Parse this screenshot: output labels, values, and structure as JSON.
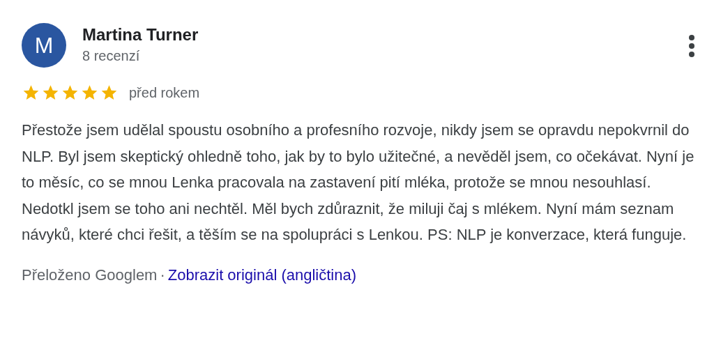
{
  "review": {
    "avatar_letter": "M",
    "author": "Martina Turner",
    "review_count": "8 recenzí",
    "stars": 5,
    "time": "před rokem",
    "text": "Přestože jsem udělal spoustu osobního a profesního rozvoje, nikdy jsem se opravdu nepokvrnil do NLP. Byl jsem skeptický ohledně toho, jak by to bylo užitečné, a nevěděl jsem, co očekávat. Nyní je to měsíc, co se mnou Lenka pracovala na zastavení pití mléka, protože se mnou nesouhlasí. Nedotkl jsem se toho ani nechtěl. Měl bych zdůraznit, že miluji čaj s mlékem. Nyní mám seznam návyků, které chci řešit, a těším se na spolupráci s Lenkou. PS: NLP je konverzace, která funguje.",
    "translated_label": "Přeloženo Googlem",
    "separator": "·",
    "original_link": "Zobrazit originál (angličtina)"
  }
}
